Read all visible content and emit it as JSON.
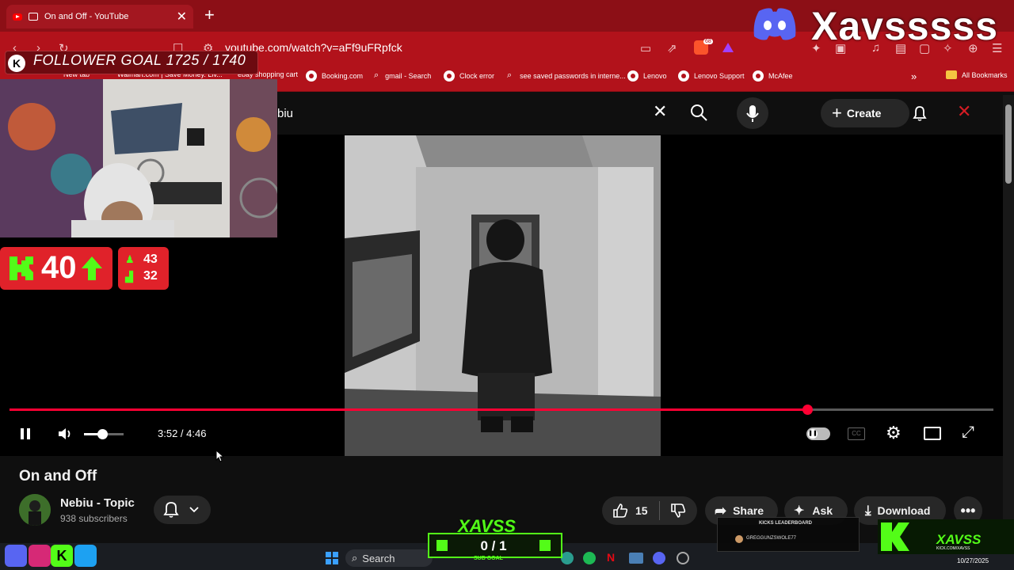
{
  "browser": {
    "tab_title": "On and Off - YouTube",
    "new_tab": "+",
    "close_tab": "✕",
    "url": "youtube.com/watch?v=aFf9uFRpfck",
    "extension_badge": "68",
    "bookmarks": [
      {
        "label": "New tab"
      },
      {
        "label": "Walmart.com | Save Money. Liv..."
      },
      {
        "label": "ebay shopping cart"
      },
      {
        "label": "Booking.com"
      },
      {
        "label": "gmail - Search"
      },
      {
        "label": "Clock error"
      },
      {
        "label": "see saved passwords in interne..."
      },
      {
        "label": "Lenovo"
      },
      {
        "label": "Lenovo Support"
      },
      {
        "label": "McAfee"
      }
    ],
    "all_bookmarks": "All Bookmarks",
    "more_bookmarks": "»"
  },
  "stream_overlay": {
    "discord_name": "Xavsssss",
    "follower_goal": "FOLLOWER GOAL 1725 / 1740",
    "follower_k": "K",
    "kick_count": "40",
    "stat_top": "43",
    "stat_bottom": "32",
    "sub_goal_brand": "XAVSS",
    "sub_goal_count": "0 / 1",
    "sub_goal_label": "SUB GOAL",
    "leaderboard_title": "KICKS LEADERBOARD",
    "leaderboard_entry": "GREGGUNZSWOLE77",
    "badge_name": "XAVSS",
    "badge_url": "KICK.COM/XAVSS",
    "colors": {
      "kick_green": "#53fc18",
      "overlay_red": "#e0222a"
    }
  },
  "youtube": {
    "search_query": "biu",
    "create_label": "Create",
    "video": {
      "current_time": "3:52",
      "duration": "4:46",
      "time_display": "3:52 / 4:46",
      "progress_fraction": 0.811,
      "volume_fraction": 0.45
    },
    "title": "On and Off",
    "channel": "Nebiu - Topic",
    "subscribers": "938 subscribers",
    "likes": "15",
    "share_label": "Share",
    "ask_label": "Ask",
    "download_label": "Download"
  },
  "taskbar": {
    "search_label": "Search",
    "date": "10/27/2025"
  },
  "icons": [
    "play-pause-icon",
    "volume-icon",
    "settings-icon",
    "captions-icon",
    "theater-icon",
    "fullscreen-icon",
    "search-icon",
    "mic-icon",
    "bell-icon",
    "like-icon",
    "dislike-icon",
    "share-icon",
    "ask-icon",
    "download-icon",
    "more-icon"
  ]
}
